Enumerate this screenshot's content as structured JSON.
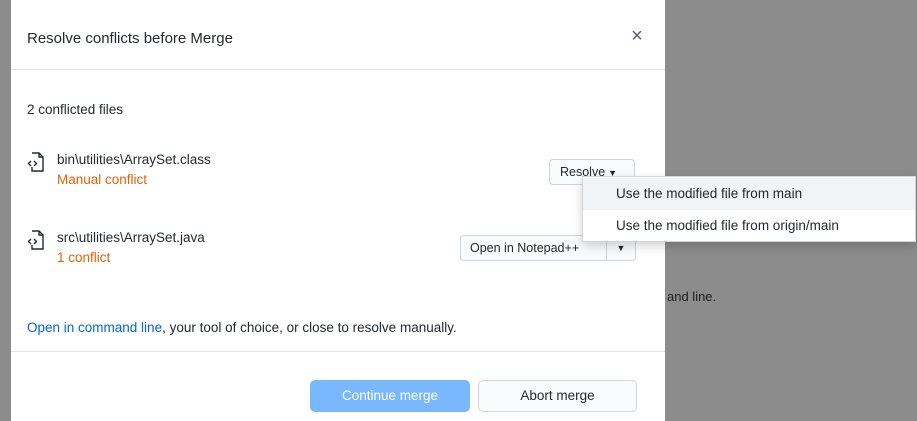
{
  "backdrop": {
    "partial_text": "and line."
  },
  "dialog": {
    "title": "Resolve conflicts before Merge",
    "close_icon": "×",
    "section_heading": "2 conflicted files",
    "files": [
      {
        "icon": "code-file-icon",
        "name": "bin\\utilities\\ArraySet.class",
        "status": "Manual conflict",
        "action_label": "Resolve",
        "caret": "▼"
      },
      {
        "icon": "code-file-icon",
        "name": "src\\utilities\\ArraySet.java",
        "status": "1 conflict",
        "action_label": "Open in Notepad++",
        "caret": "▼"
      }
    ],
    "footer": {
      "link_text": "Open in command line",
      "rest_text": ", your tool of choice, or close to resolve manually."
    },
    "buttons": {
      "continue": "Continue merge",
      "abort": "Abort merge"
    }
  },
  "dropdown": {
    "items": [
      "Use the modified file from main",
      "Use the modified file from origin/main"
    ]
  },
  "colors": {
    "accent_link": "#0366d6",
    "conflict_orange": "#e36209",
    "primary_button_disabled": "#79b8ff",
    "overlay_gray": "#8c8c8c"
  }
}
